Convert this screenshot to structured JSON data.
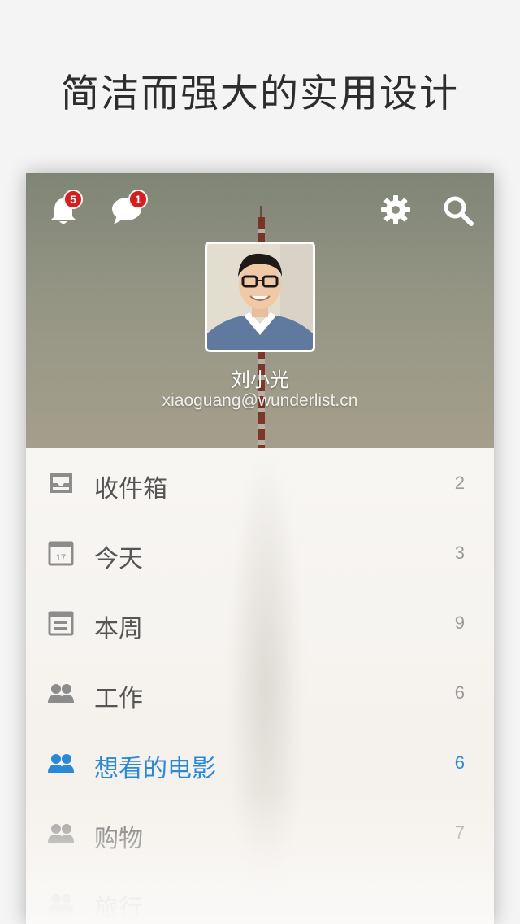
{
  "headline": "简洁而强大的实用设计",
  "header": {
    "notifications_badge": "5",
    "messages_badge": "1"
  },
  "profile": {
    "name": "刘小光",
    "email": "xiaoguang@wunderlist.cn"
  },
  "lists": [
    {
      "label": "收件箱",
      "count": "2",
      "icon": "inbox-icon"
    },
    {
      "label": "今天",
      "count": "3",
      "icon": "calendar-icon",
      "icon_text": "17"
    },
    {
      "label": "本周",
      "count": "9",
      "icon": "week-icon"
    },
    {
      "label": "工作",
      "count": "6",
      "icon": "shared-list-icon"
    },
    {
      "label": "想看的电影",
      "count": "6",
      "icon": "shared-list-icon",
      "active": true
    },
    {
      "label": "购物",
      "count": "7",
      "icon": "shared-list-icon"
    },
    {
      "label": "旅行",
      "count": "",
      "icon": "shared-list-icon"
    }
  ],
  "colors": {
    "accent": "#2b88d8",
    "badge": "#d21f1f",
    "text": "#555555",
    "count": "#9a9a9a"
  }
}
